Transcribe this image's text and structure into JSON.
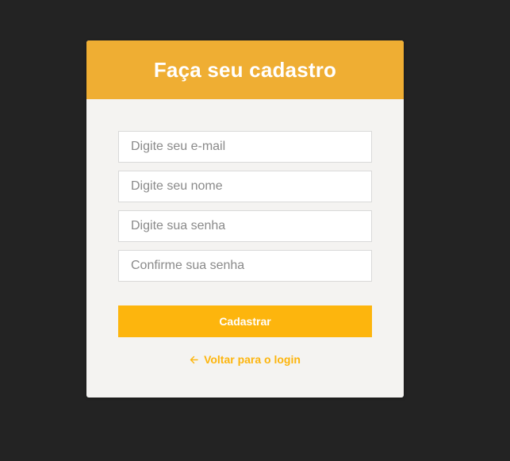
{
  "header": {
    "title": "Faça seu cadastro"
  },
  "form": {
    "email_placeholder": "Digite seu e-mail",
    "name_placeholder": "Digite seu nome",
    "password_placeholder": "Digite sua senha",
    "confirm_password_placeholder": "Confirme sua senha",
    "submit_label": "Cadastrar",
    "back_link_label": "Voltar para o login",
    "back_link_icon": "arrow-left-icon"
  },
  "colors": {
    "background": "#232323",
    "card": "#f4f3f1",
    "header": "#efae33",
    "accent": "#fdb50d"
  }
}
